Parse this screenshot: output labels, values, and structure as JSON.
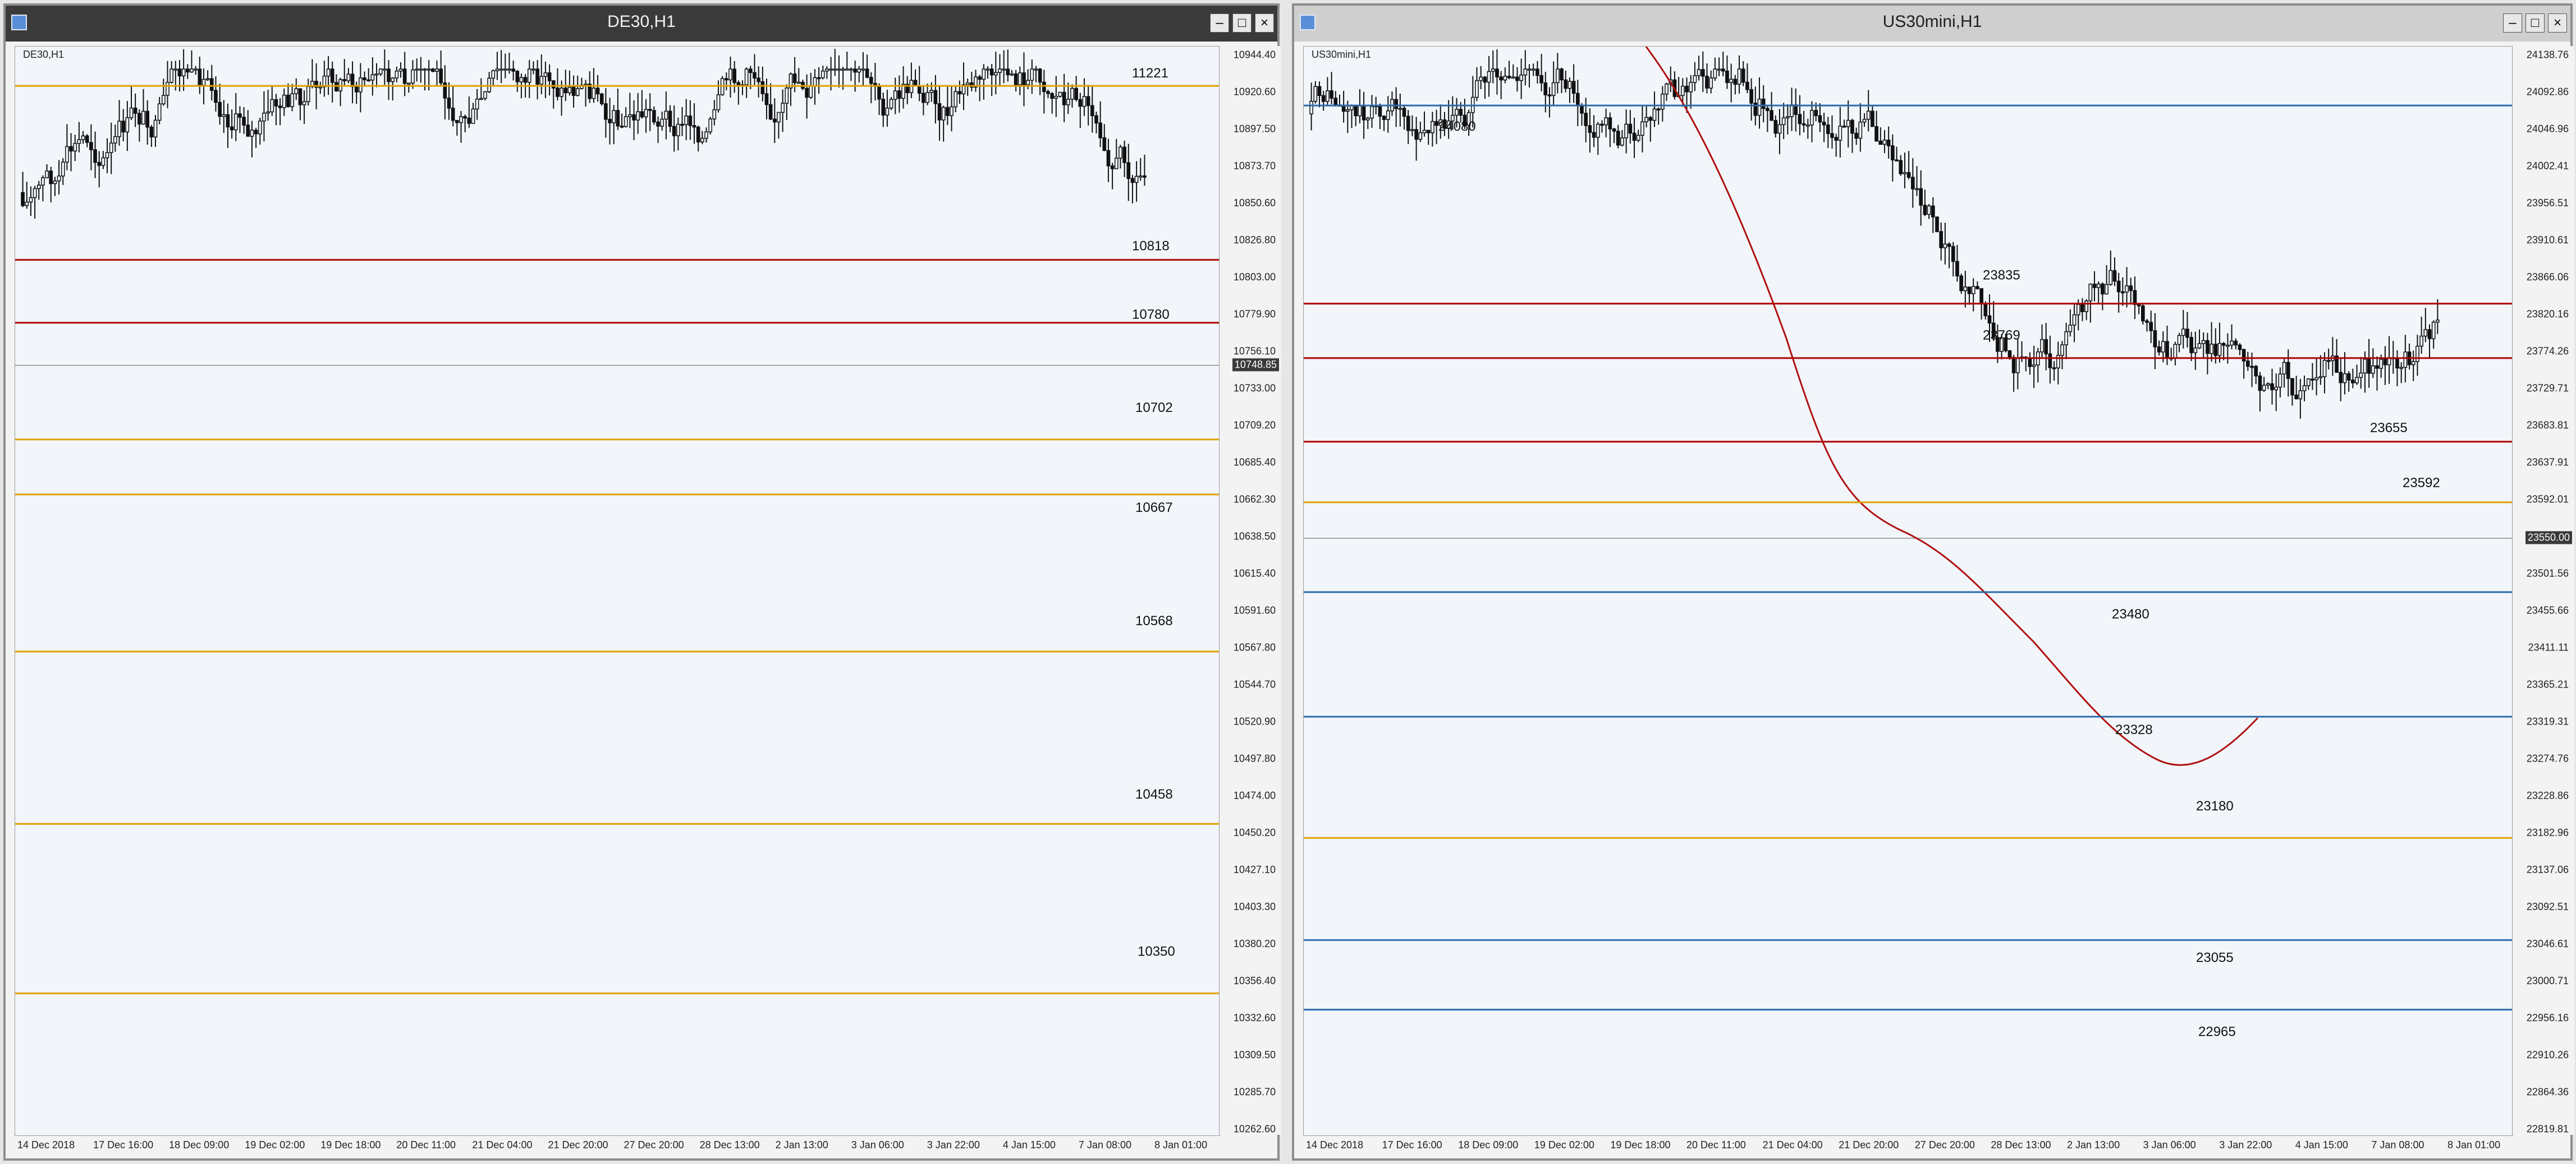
{
  "windows": [
    {
      "title": "DE30,H1",
      "symbol_label": "DE30,H1",
      "current_price": "10748.85",
      "price_ticks": [
        "10944.40",
        "10920.60",
        "10897.50",
        "10873.70",
        "10850.60",
        "10826.80",
        "10803.00",
        "10779.90",
        "10756.10",
        "10733.00",
        "10709.20",
        "10685.40",
        "10662.30",
        "10638.50",
        "10615.40",
        "10591.60",
        "10567.80",
        "10544.70",
        "10520.90",
        "10497.80",
        "10474.00",
        "10450.20",
        "10427.10",
        "10403.30",
        "10380.20",
        "10356.40",
        "10332.60",
        "10309.50",
        "10285.70",
        "10262.60"
      ],
      "time_labels": [
        "14 Dec 2018",
        "17 Dec 16:00",
        "18 Dec 09:00",
        "19 Dec 02:00",
        "19 Dec 18:00",
        "20 Dec 11:00",
        "21 Dec 04:00",
        "21 Dec 20:00",
        "27 Dec 20:00",
        "28 Dec 13:00",
        "2 Jan 13:00",
        "3 Jan 06:00",
        "3 Jan 22:00",
        "4 Jan 15:00",
        "7 Jan 08:00",
        "8 Jan 01:00"
      ],
      "levels": [
        {
          "label": "11221",
          "color": "#e0a000"
        },
        {
          "label": "10818",
          "color": "#b00000"
        },
        {
          "label": "10780",
          "color": "#b00000"
        },
        {
          "label": "10702",
          "color": "#e0a000"
        },
        {
          "label": "10667",
          "color": "#e0a000"
        },
        {
          "label": "10568",
          "color": "#e0a000"
        },
        {
          "label": "10458",
          "color": "#e0a000"
        },
        {
          "label": "10350",
          "color": "#e0a000"
        }
      ]
    },
    {
      "title": "US30mini,H1",
      "symbol_label": "US30mini,H1",
      "current_price": "23550.00",
      "price_ticks": [
        "24138.76",
        "24092.86",
        "24046.96",
        "24002.41",
        "23956.51",
        "23910.61",
        "23866.06",
        "23820.16",
        "23774.26",
        "23729.71",
        "23683.81",
        "23637.91",
        "23592.01",
        "23547.46",
        "23501.56",
        "23455.66",
        "23411.11",
        "23365.21",
        "23319.31",
        "23274.76",
        "23228.86",
        "23182.96",
        "23137.06",
        "23092.51",
        "23046.61",
        "23000.71",
        "22956.16",
        "22910.26",
        "22864.36",
        "22819.81"
      ],
      "time_labels": [
        "14 Dec 2018",
        "17 Dec 16:00",
        "18 Dec 09:00",
        "19 Dec 02:00",
        "19 Dec 18:00",
        "20 Dec 11:00",
        "21 Dec 04:00",
        "21 Dec 20:00",
        "27 Dec 20:00",
        "28 Dec 13:00",
        "2 Jan 13:00",
        "3 Jan 06:00",
        "3 Jan 22:00",
        "4 Jan 15:00",
        "7 Jan 08:00",
        "8 Jan 01:00"
      ],
      "levels": [
        {
          "label": "24080",
          "color": "#2a6aaa"
        },
        {
          "label": "23835",
          "color": "#b00000"
        },
        {
          "label": "23769",
          "color": "#b00000"
        },
        {
          "label": "23655",
          "color": "#b00000"
        },
        {
          "label": "23592",
          "color": "#e0a000"
        },
        {
          "label": "23480",
          "color": "#2a6aaa"
        },
        {
          "label": "23328",
          "color": "#2a6aaa"
        },
        {
          "label": "23180",
          "color": "#e0a000"
        },
        {
          "label": "23055",
          "color": "#2a6aaa"
        },
        {
          "label": "22965",
          "color": "#2a6aaa"
        }
      ]
    }
  ]
}
